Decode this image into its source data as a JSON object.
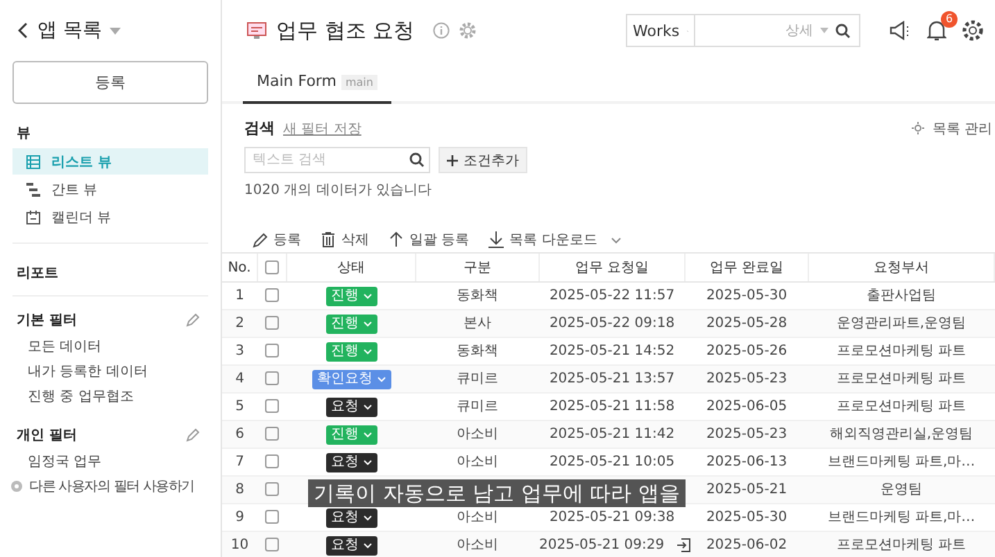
{
  "sidebar": {
    "back": "앱 목록",
    "register_button": "등록",
    "sections": [
      {
        "title": "뷰",
        "items": [
          {
            "label": "리스트 뷰",
            "selected": true
          },
          {
            "label": "간트 뷰",
            "selected": false
          },
          {
            "label": "캘린더 뷰",
            "selected": false
          }
        ]
      },
      {
        "title": "리포트"
      }
    ],
    "filters": [
      {
        "title": "기본 필터",
        "items": [
          "모든 데이터",
          "내가 등록한 데이터",
          "진행 중 업무협조"
        ]
      },
      {
        "title": "개인 필터",
        "items": [
          "임정국 업무"
        ]
      }
    ],
    "other_filter_link": "다른 사용자의 필터 사용하기"
  },
  "header": {
    "title": "업무 협조 요청",
    "scope_select": "Works",
    "search_detail": "상세",
    "notification_count": "6"
  },
  "tabs": [
    {
      "label": "Main Form",
      "badge": "main",
      "selected": true
    }
  ],
  "search": {
    "title": "검색",
    "save_filter_link": "새 필터 저장",
    "placeholder": "텍스트 검색",
    "add_condition_button": "조건추가",
    "count_text": "1020 개의 데이터가 있습니다",
    "manage_link": "목록 관리"
  },
  "toolbar": [
    "등록",
    "삭제",
    "일괄 등록",
    "목록 다운로드"
  ],
  "table": {
    "columns": [
      "No.",
      "상태",
      "구분",
      "업무 요청일",
      "업무 완료일",
      "요청부서"
    ],
    "all_checked": false,
    "rows": [
      {
        "no": "1",
        "checked": false,
        "status": "진행",
        "kind": "progress",
        "category": "동화책",
        "requested": "2025-05-22 11:57",
        "completed": "2025-05-30",
        "department": "출판사업팀"
      },
      {
        "no": "2",
        "checked": false,
        "status": "진행",
        "kind": "progress",
        "category": "본사",
        "requested": "2025-05-22 09:18",
        "completed": "2025-05-28",
        "department": "운영관리파트,운영팀"
      },
      {
        "no": "3",
        "checked": false,
        "status": "진행",
        "kind": "progress",
        "category": "동화책",
        "requested": "2025-05-21 14:52",
        "completed": "2025-05-26",
        "department": "프로모션마케팅 파트"
      },
      {
        "no": "4",
        "checked": false,
        "status": "확인요청",
        "kind": "confirm",
        "category": "큐미르",
        "requested": "2025-05-21 13:57",
        "completed": "2025-05-23",
        "department": "프로모션마케팅 파트"
      },
      {
        "no": "5",
        "checked": false,
        "status": "요청",
        "kind": "request",
        "category": "큐미르",
        "requested": "2025-05-21 11:58",
        "completed": "2025-06-05",
        "department": "프로모션마케팅 파트"
      },
      {
        "no": "6",
        "checked": false,
        "status": "진행",
        "kind": "progress",
        "category": "아소비",
        "requested": "2025-05-21 11:42",
        "completed": "2025-05-23",
        "department": "해외직영관리실,운영팀"
      },
      {
        "no": "7",
        "checked": false,
        "status": "요청",
        "kind": "request",
        "category": "아소비",
        "requested": "2025-05-21 10:05",
        "completed": "2025-06-13",
        "department": "브랜드마케팅 파트,마…"
      },
      {
        "no": "8",
        "checked": false,
        "completed": "2025-05-21",
        "department": "운영팀"
      },
      {
        "no": "9",
        "checked": false,
        "status": "요청",
        "kind": "request",
        "category": "아소비",
        "requested": "2025-05-21 09:38",
        "completed": "2025-05-30",
        "department": "브랜드마케팅 파트,마…"
      },
      {
        "no": "10",
        "checked": false,
        "status": "요청",
        "kind": "request",
        "category": "아소비",
        "requested": "2025-05-21 09:29",
        "completed": "2025-06-02",
        "department": "프로모션마케팅 파트",
        "open_icon": true
      }
    ]
  },
  "caption": "기록이 자동으로 남고 업무에 따라 앱을"
}
